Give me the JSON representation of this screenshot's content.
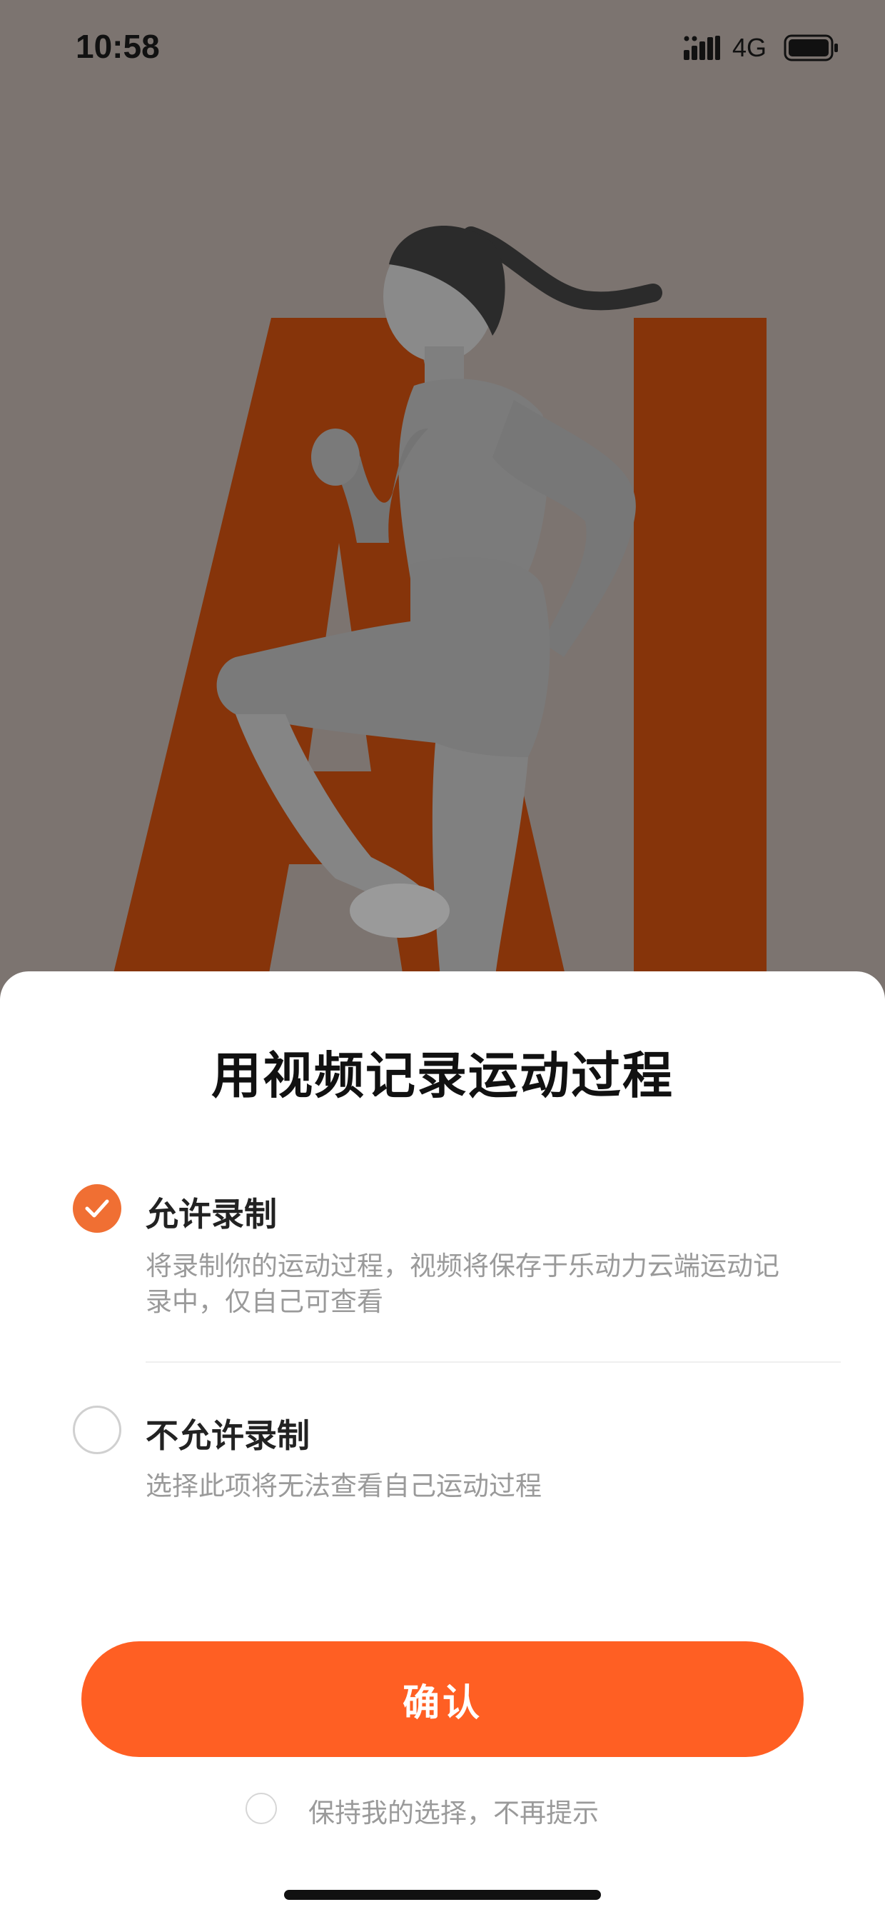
{
  "status_bar": {
    "time": "10:58",
    "network": "4G"
  },
  "hero": {
    "letters": "AI"
  },
  "sheet": {
    "title": "用视频记录运动过程",
    "options": [
      {
        "label": "允许录制",
        "description_line1": "将录制你的运动过程，视频将保存于乐动力云端运动记",
        "description_line2": "录中，仅自己可查看",
        "selected": true
      },
      {
        "label": "不允许录制",
        "description": "选择此项将无法查看自己运动过程",
        "selected": false
      }
    ],
    "confirm_label": "确认",
    "remember_label": "保持我的选择，不再提示"
  },
  "colors": {
    "accent": "#ff5f23",
    "check": "#f06f33",
    "hero_bg": "#7c7470",
    "hero_letters": "#86340a"
  },
  "icons": [
    "signal-icon",
    "battery-icon",
    "check-icon"
  ]
}
